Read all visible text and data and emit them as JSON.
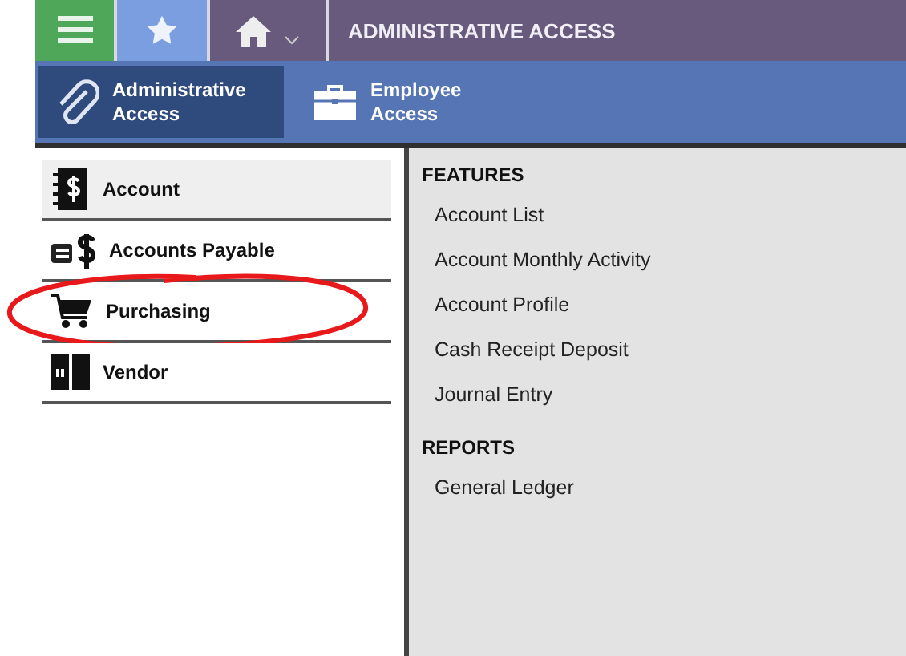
{
  "top_bar": {
    "title": "ADMINISTRATIVE ACCESS"
  },
  "access_tabs": [
    {
      "label": "Administrative Access",
      "kind": "clip",
      "selected": true
    },
    {
      "label": "Employee Access",
      "kind": "briefcase",
      "selected": false
    }
  ],
  "sidebar": {
    "items": [
      {
        "label": "Account",
        "kind": "ledger",
        "selected": true
      },
      {
        "label": "Accounts Payable",
        "kind": "payable",
        "selected": false
      },
      {
        "label": "Purchasing",
        "kind": "cart",
        "selected": false,
        "circled": true
      },
      {
        "label": "Vendor",
        "kind": "vendor",
        "selected": false
      }
    ]
  },
  "sections": [
    {
      "heading": "FEATURES",
      "items": [
        "Account List",
        "Account Monthly Activity",
        "Account Profile",
        "Cash Receipt Deposit",
        "Journal Entry"
      ]
    },
    {
      "heading": "REPORTS",
      "items": [
        "General Ledger"
      ]
    }
  ]
}
